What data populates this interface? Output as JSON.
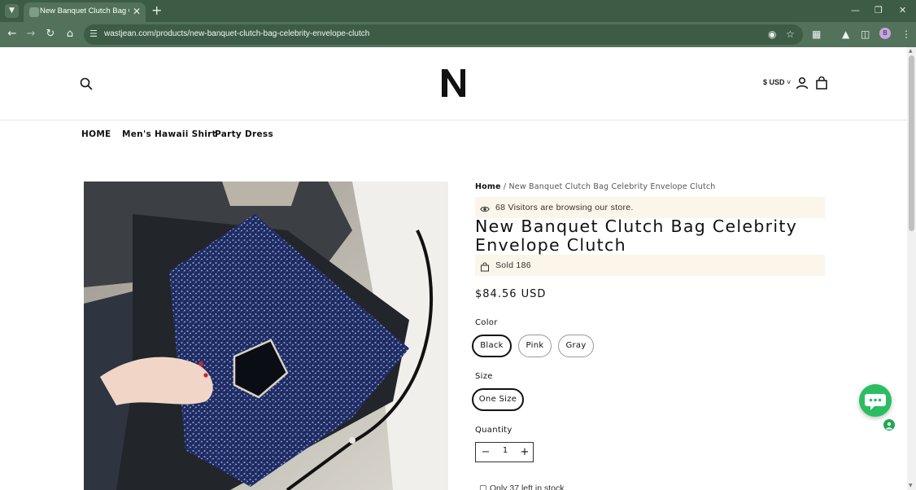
{
  "browser": {
    "tab_title": "New Banquet Clutch Bag Celebrity Envelope Clutch",
    "url": "wastjean.com/products/new-banquet-clutch-bag-celebrity-envelope-clutch",
    "profile_initial": "B",
    "accent_color": "#3d5c46"
  },
  "header": {
    "currency": "$ USD",
    "logo_letter": "N"
  },
  "nav": {
    "items": [
      "HOME",
      "Men's Hawaii Shirt",
      "Party Dress"
    ]
  },
  "product": {
    "breadcrumb": {
      "home": "Home",
      "separator": "/",
      "current": "New Banquet Clutch Bag Celebrity Envelope Clutch"
    },
    "visitors_text": "68 Visitors are browsing our store.",
    "title": "New Banquet Clutch Bag Celebrity Envelope Clutch",
    "sold_text": "Sold 186",
    "price": "$84.56 USD",
    "color_label": "Color",
    "colors": [
      {
        "label": "Black",
        "selected": true
      },
      {
        "label": "Pink",
        "selected": false
      },
      {
        "label": "Gray",
        "selected": false
      }
    ],
    "size_label": "Size",
    "sizes": [
      {
        "label": "One Size",
        "selected": true
      }
    ],
    "quantity_label": "Quantity",
    "quantity": "1",
    "stock_text": "Only 37 left in stock"
  },
  "icons": {
    "search": "search-icon",
    "account": "user-icon",
    "cart": "shopping-bag-icon",
    "eye": "eye-icon",
    "bag": "bag-icon",
    "chat": "chat-icon"
  },
  "colors": {
    "notice_bg": "#fbf5ea",
    "chat_green": "#2bbd62",
    "text": "#111111"
  }
}
